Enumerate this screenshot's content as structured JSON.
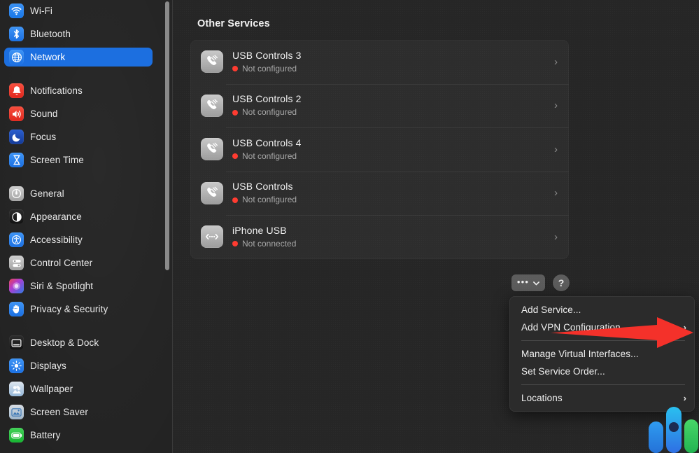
{
  "sidebar": {
    "scrollbar": {
      "name": "sidebar-scrollbar"
    },
    "groups": [
      {
        "items": [
          {
            "label": "Wi-Fi",
            "icon": "wifi-icon",
            "selected": false
          },
          {
            "label": "Bluetooth",
            "icon": "bluetooth-icon",
            "selected": false
          },
          {
            "label": "Network",
            "icon": "network-globe-icon",
            "selected": true
          }
        ]
      },
      {
        "items": [
          {
            "label": "Notifications",
            "icon": "notifications-bell-icon",
            "selected": false
          },
          {
            "label": "Sound",
            "icon": "sound-speaker-icon",
            "selected": false
          },
          {
            "label": "Focus",
            "icon": "focus-moon-icon",
            "selected": false
          },
          {
            "label": "Screen Time",
            "icon": "screen-time-hourglass-icon",
            "selected": false
          }
        ]
      },
      {
        "items": [
          {
            "label": "General",
            "icon": "general-gear-icon",
            "selected": false
          },
          {
            "label": "Appearance",
            "icon": "appearance-contrast-icon",
            "selected": false
          },
          {
            "label": "Accessibility",
            "icon": "accessibility-person-icon",
            "selected": false
          },
          {
            "label": "Control Center",
            "icon": "control-center-icon",
            "selected": false
          },
          {
            "label": "Siri & Spotlight",
            "icon": "siri-icon",
            "selected": false
          },
          {
            "label": "Privacy & Security",
            "icon": "privacy-hand-icon",
            "selected": false
          }
        ]
      },
      {
        "items": [
          {
            "label": "Desktop & Dock",
            "icon": "desktop-dock-icon",
            "selected": false
          },
          {
            "label": "Displays",
            "icon": "displays-brightness-icon",
            "selected": false
          },
          {
            "label": "Wallpaper",
            "icon": "wallpaper-icon",
            "selected": false
          },
          {
            "label": "Screen Saver",
            "icon": "screen-saver-icon",
            "selected": false
          },
          {
            "label": "Battery",
            "icon": "battery-icon",
            "selected": false
          }
        ]
      }
    ]
  },
  "main": {
    "section_title": "Other Services",
    "services": [
      {
        "name": "USB Controls 3",
        "status": "Not configured",
        "status_color": "#ff3b30",
        "icon": "modem-phone-icon",
        "chevron": "›"
      },
      {
        "name": "USB Controls 2",
        "status": "Not configured",
        "status_color": "#ff3b30",
        "icon": "modem-phone-icon",
        "chevron": "›"
      },
      {
        "name": "USB Controls 4",
        "status": "Not configured",
        "status_color": "#ff3b30",
        "icon": "modem-phone-icon",
        "chevron": "›"
      },
      {
        "name": "USB Controls",
        "status": "Not configured",
        "status_color": "#ff3b30",
        "icon": "modem-phone-icon",
        "chevron": "›"
      },
      {
        "name": "iPhone USB",
        "status": "Not connected",
        "status_color": "#ff3b30",
        "icon": "usb-connector-icon",
        "chevron": "›"
      }
    ],
    "toolbar": {
      "more_dots": "•••",
      "more_chevron": "chevron-down-icon",
      "help_label": "?"
    }
  },
  "popup_menu": {
    "items": [
      {
        "label": "Add Service...",
        "submenu": false,
        "chevron": ""
      },
      {
        "label": "Add VPN Configuration",
        "submenu": true,
        "chevron": "›"
      },
      {
        "label": "Manage Virtual Interfaces...",
        "submenu": false,
        "chevron": ""
      },
      {
        "label": "Set Service Order...",
        "submenu": false,
        "chevron": ""
      },
      {
        "label": "Locations",
        "submenu": true,
        "chevron": "›"
      }
    ]
  },
  "annotation": {
    "arrow_color": "#f4312a",
    "points_to": "Add VPN Configuration"
  },
  "colors": {
    "accent_selected": "#1c6fe0",
    "status_red": "#ff3b30",
    "page_background": "#262626",
    "sidebar_background": "#232323",
    "card_background": "#2d2d2d",
    "menu_background": "#2b2b2b"
  }
}
